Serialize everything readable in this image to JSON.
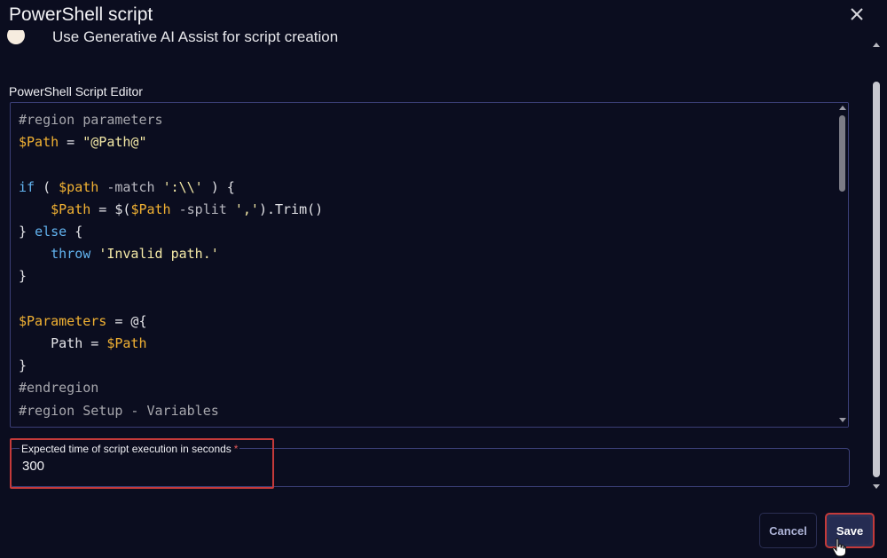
{
  "dialog": {
    "title": "PowerShell script",
    "close_icon": "close-icon"
  },
  "ai_assist": {
    "label": "Use Generative AI Assist for script creation"
  },
  "editor": {
    "label": "PowerShell Script Editor",
    "lines": [
      "#region parameters",
      "$Path = \"@Path@\"",
      "",
      "if ( $path -match ':\\\\' ) {",
      "    $Path = $($Path -split ',').Trim()",
      "} else {",
      "    throw 'Invalid path.'",
      "}",
      "",
      "$Parameters = @{",
      "    Path = $Path",
      "}",
      "#endregion",
      "#region Setup - Variables"
    ]
  },
  "time_field": {
    "label": "Expected time of script execution in seconds",
    "required_mark": "*",
    "value": "300"
  },
  "footer": {
    "cancel_label": "Cancel",
    "save_label": "Save"
  },
  "colors": {
    "background": "#0b0d1f",
    "accent_border": "#3b3f77",
    "highlight": "#c43a3a",
    "variable": "#f2b233",
    "keyword": "#62b3ef",
    "string": "#f3e8a6"
  }
}
